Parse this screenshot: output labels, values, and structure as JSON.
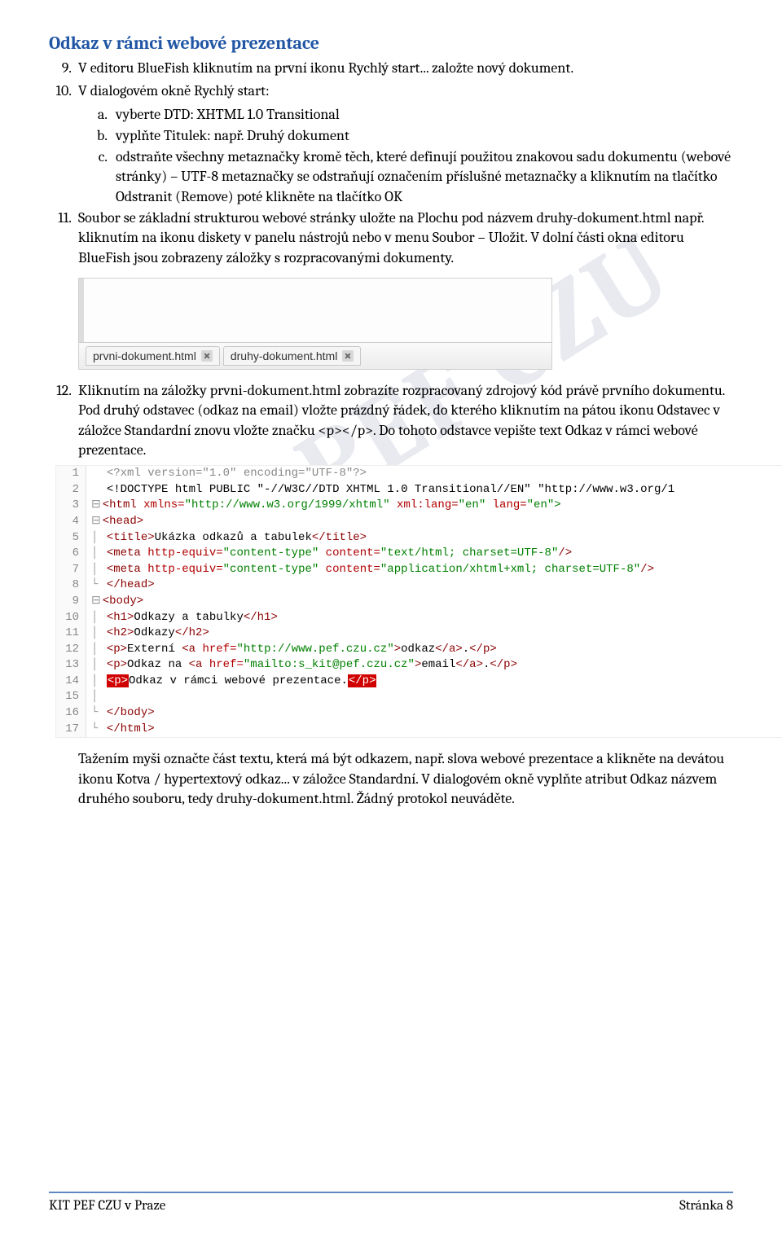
{
  "heading": "Odkaz v rámci webové prezentace",
  "items": {
    "i9": {
      "num": "9.",
      "text": "V editoru BlueFish kliknutím na první ikonu Rychlý start... založte nový dokument."
    },
    "i10": {
      "num": "10.",
      "text": "V dialogovém okně Rychlý start:"
    },
    "i10a": {
      "letter": "a.",
      "text": "vyberte DTD: XHTML 1.0 Transitional"
    },
    "i10b": {
      "letter": "b.",
      "text": "vyplňte Titulek: např. Druhý dokument"
    },
    "i10c": {
      "letter": "c.",
      "text": "odstraňte všechny metaznačky kromě těch, které definují použitou znakovou sadu dokumentu (webové stránky) – UTF-8 metaznačky se odstraňují označením příslušné metaznačky a kliknutím na tlačítko Odstranit (Remove) poté klikněte na tlačítko OK"
    },
    "i11": {
      "num": "11.",
      "text": "Soubor se základní strukturou webové stránky uložte na Plochu pod názvem druhy-dokument.html např. kliknutím na ikonu diskety v panelu nástrojů nebo v menu Soubor – Uložit. V dolní části okna editoru BlueFish jsou zobrazeny záložky s rozpracovanými dokumenty."
    },
    "i12": {
      "num": "12.",
      "text": "Kliknutím na záložky prvni-dokument.html zobrazíte rozpracovaný zdrojový kód právě prvního dokumentu. Pod druhý odstavec (odkaz na email) vložte prázdný řádek, do kterého kliknutím na pátou ikonu Odstavec v záložce Standardní znovu vložte značku <p></p>. Do tohoto odstavce vepište text Odkaz v rámci webové prezentace."
    }
  },
  "tabs": {
    "tab1": "prvni-dokument.html",
    "tab2": "druhy-dokument.html"
  },
  "code": {
    "l1": "<?xml version=\"1.0\" encoding=\"UTF-8\"?>",
    "l2a": "<!DOCTYPE html PUBLIC ",
    "l2b": "\"-//W3C//DTD XHTML 1.0 Transitional//EN\"",
    "l2c": " \"http://www.w3.org/1",
    "l3a": "<html",
    "l3b": " xmlns=",
    "l3c": "\"http://www.w3.org/1999/xhtml\"",
    "l3d": " xml:lang=",
    "l3e": "\"en\"",
    "l3f": " lang=",
    "l3g": "\"en\">",
    "l4": "<head>",
    "l5a": "<title>",
    "l5b": "Ukázka odkazů a tabulek",
    "l5c": "</title>",
    "l6a": "<meta",
    "l6b": " http-equiv=",
    "l6c": "\"content-type\"",
    "l6d": " content=",
    "l6e": "\"text/html; charset=UTF-8\"",
    "l6f": "/>",
    "l7a": "<meta",
    "l7b": " http-equiv=",
    "l7c": "\"content-type\"",
    "l7d": " content=",
    "l7e": "\"application/xhtml+xml; charset=UTF-8\"",
    "l7f": "/>",
    "l8": "</head>",
    "l9": "<body>",
    "l10a": "<h1>",
    "l10b": "Odkazy a tabulky",
    "l10c": "</h1>",
    "l11a": "<h2>",
    "l11b": "Odkazy",
    "l11c": "</h2>",
    "l12a": "<p>",
    "l12b": "Externí ",
    "l12c": "<a",
    "l12d": " href=",
    "l12e": "\"http://www.pef.czu.cz\"",
    "l12f": ">",
    "l12g": "odkaz",
    "l12h": "</a>",
    "l12i": ".",
    "l12j": "</p>",
    "l13a": "<p>",
    "l13b": "Odkaz na ",
    "l13c": "<a",
    "l13d": " href=",
    "l13e": "\"mailto:s_kit@pef.czu.cz\"",
    "l13f": ">",
    "l13g": "email",
    "l13h": "</a>",
    "l13i": ".",
    "l13j": "</p>",
    "l14a": "<p>",
    "l14b": "Odkaz v rámci webové prezentace.",
    "l14c": "</p>",
    "l16": "</body>",
    "l17": "</html>"
  },
  "after12": "Tažením myši označte část textu, která má být odkazem, např. slova webové prezentace a klikněte na devátou ikonu Kotva / hypertextový odkaz... v záložce Standardní. V dialogovém okně vyplňte atribut Odkaz názvem druhého souboru, tedy druhy-dokument.html. Žádný protokol neuváděte.",
  "footer": {
    "left": "KIT PEF CZU v Praze",
    "right": "Stránka 8"
  },
  "watermark": "PEF CZU"
}
